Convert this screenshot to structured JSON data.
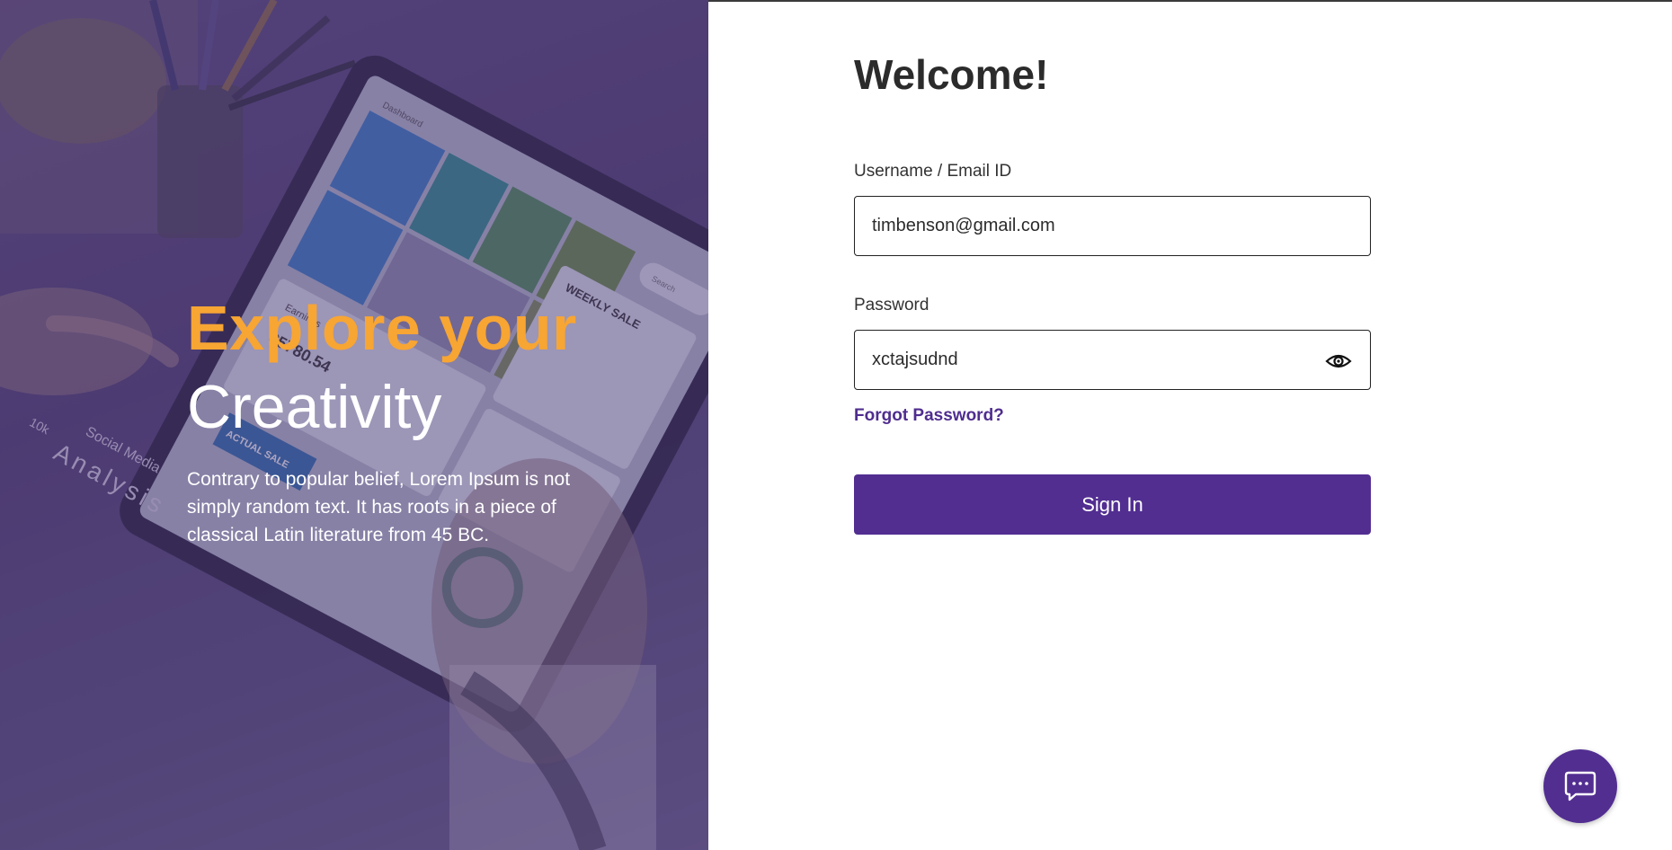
{
  "hero": {
    "title_line1": "Explore your",
    "title_line2": "Creativity",
    "description": "Contrary to popular belief, Lorem Ipsum is not simply random text. It has roots in a piece of classical Latin literature from 45 BC.",
    "tablet_text": {
      "dashboard": "Dashboard",
      "search": "Search",
      "weekly_sale": "WEEKLY SALE",
      "earnings": "Earnings",
      "amount": "$5780.54",
      "actual_sale": "ACTUAL SALE",
      "paper_text": "Social Media",
      "paper_analysis": "Analysis",
      "paper_10k": "10k"
    }
  },
  "login": {
    "heading": "Welcome!",
    "username_label": "Username / Email ID",
    "username_value": "timbenson@gmail.com",
    "password_label": "Password",
    "password_value": "xctajsudnd",
    "forgot_link": "Forgot Password?",
    "signin_label": "Sign In"
  },
  "icons": {
    "password_toggle": "eye-icon",
    "chat": "chat-bubble-icon"
  },
  "colors": {
    "accent": "#522e91",
    "hero_highlight": "#f7a533",
    "text_dark": "#2b2b2b"
  }
}
